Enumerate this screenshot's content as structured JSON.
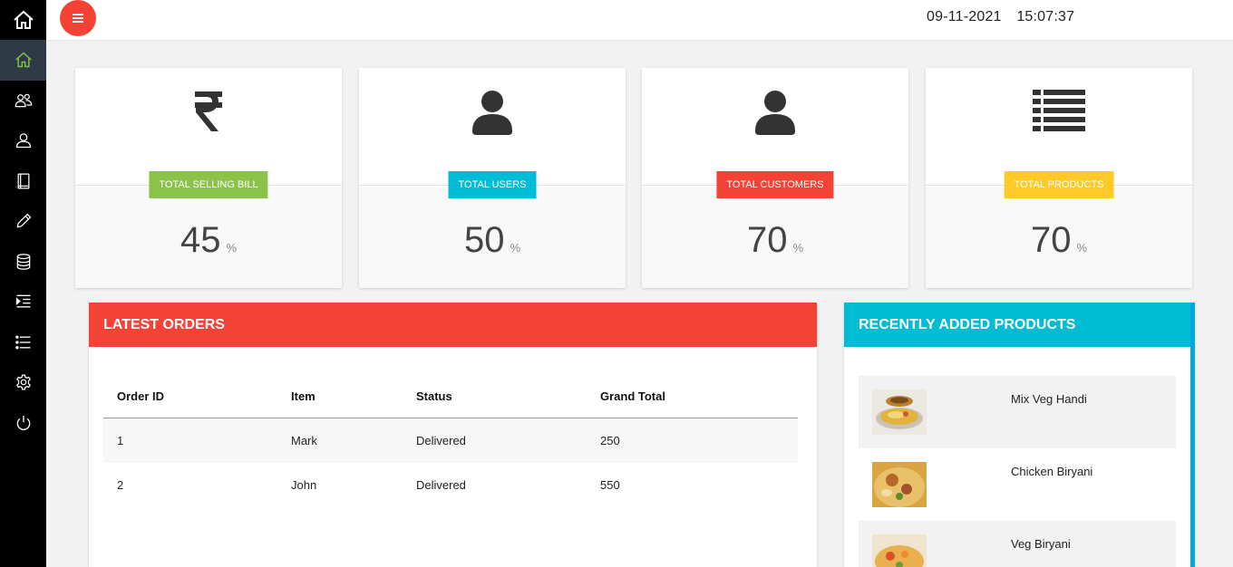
{
  "sidebar": {
    "items": [
      {
        "icon": "home-icon"
      },
      {
        "icon": "users-icon"
      },
      {
        "icon": "user-icon"
      },
      {
        "icon": "book-icon"
      },
      {
        "icon": "pencil-icon"
      },
      {
        "icon": "database-icon"
      },
      {
        "icon": "indent-icon"
      },
      {
        "icon": "list-icon"
      },
      {
        "icon": "settings-icon"
      },
      {
        "icon": "power-icon"
      }
    ]
  },
  "header": {
    "date": "09-11-2021",
    "time": "15:07:37",
    "menu_color": "#f44336"
  },
  "stats": [
    {
      "label": "TOTAL SELLING BILL",
      "value": "45",
      "unit": "%",
      "icon": "rupee-icon",
      "color": "#8bc34a"
    },
    {
      "label": "TOTAL USERS",
      "value": "50",
      "unit": "%",
      "icon": "user-icon",
      "color": "#00bcd4"
    },
    {
      "label": "TOTAL CUSTOMERS",
      "value": "70",
      "unit": "%",
      "icon": "user-icon",
      "color": "#f44336"
    },
    {
      "label": "TOTAL PRODUCTS",
      "value": "70",
      "unit": "%",
      "icon": "list-icon",
      "color": "#ffc928"
    }
  ],
  "orders": {
    "title": "LATEST ORDERS",
    "color": "#f44336",
    "columns": [
      "Order ID",
      "Item",
      "Status",
      "Grand Total"
    ],
    "rows": [
      [
        "1",
        "Mark",
        "Delivered",
        "250"
      ],
      [
        "2",
        "John",
        "Delivered",
        "550"
      ]
    ]
  },
  "products": {
    "title": "RECENTLY ADDED PRODUCTS",
    "color": "#00bcd4",
    "items": [
      {
        "name": "Mix Veg Handi"
      },
      {
        "name": "Chicken Biryani"
      },
      {
        "name": "Veg Biryani"
      }
    ]
  }
}
